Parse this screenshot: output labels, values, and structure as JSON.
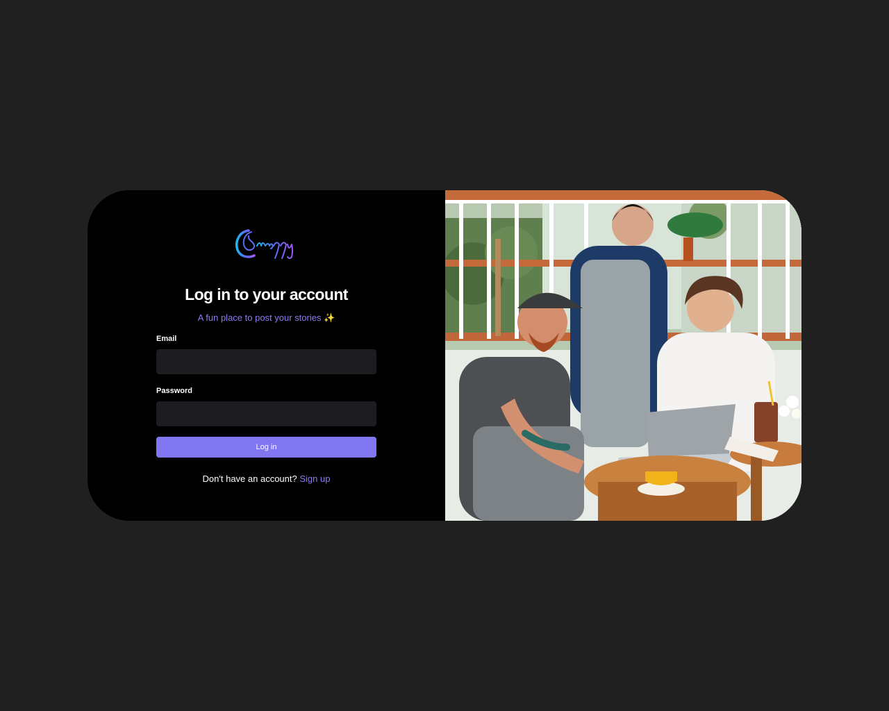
{
  "brand": {
    "name": "Snappy"
  },
  "login": {
    "title": "Log in to your account",
    "subtitle": "A fun place to post your stories ✨",
    "email_label": "Email",
    "email_value": "",
    "password_label": "Password",
    "password_value": "",
    "submit_label": "Log in",
    "signup_prompt": "Don't have an account?",
    "signup_link": "Sign up"
  },
  "hero_image": {
    "subject": "cafe-team-photo"
  },
  "colors": {
    "background": "#202020",
    "card": "#000000",
    "accent": "#8177f3",
    "accent_text": "#8b7cf6",
    "input_bg": "#1d1d21"
  }
}
